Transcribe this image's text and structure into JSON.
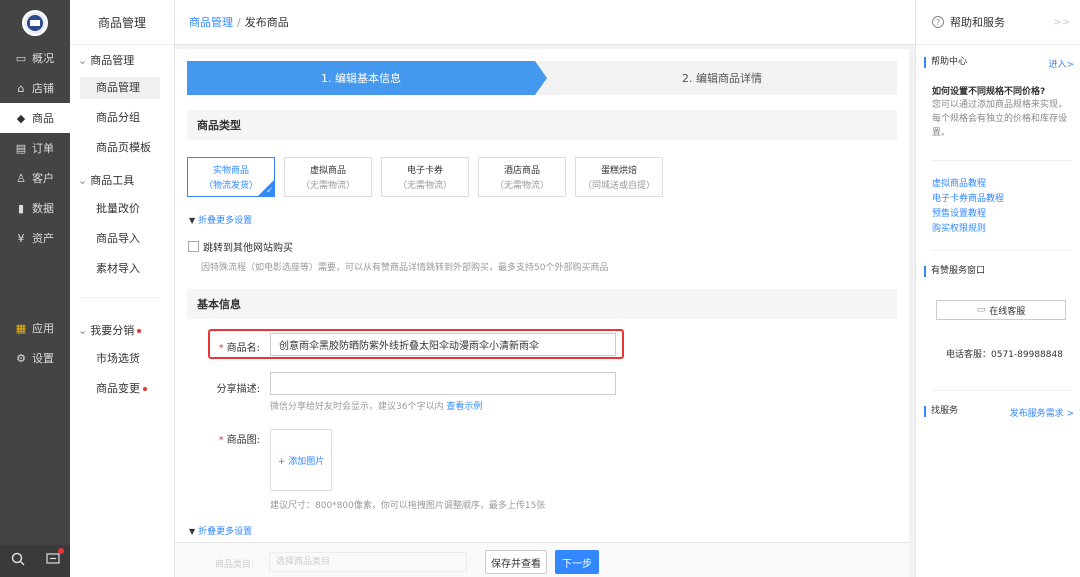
{
  "nav": {
    "items": [
      {
        "icon": "monitor-icon",
        "glyph": "▭",
        "label": "概况"
      },
      {
        "icon": "store-icon",
        "glyph": "⌂",
        "label": "店铺"
      },
      {
        "icon": "tag-icon",
        "glyph": "◆",
        "label": "商品"
      },
      {
        "icon": "order-icon",
        "glyph": "▤",
        "label": "订单"
      },
      {
        "icon": "customer-icon",
        "glyph": "♙",
        "label": "客户"
      },
      {
        "icon": "data-icon",
        "glyph": "▮",
        "label": "数据"
      },
      {
        "icon": "asset-icon",
        "glyph": "¥",
        "label": "资产"
      },
      {
        "icon": "apps-icon",
        "glyph": "▦",
        "label": "应用"
      },
      {
        "icon": "settings-icon",
        "glyph": "⚙",
        "label": "设置"
      }
    ]
  },
  "sub": {
    "title": "商品管理",
    "group1": "商品管理",
    "group1_items": [
      "商品管理",
      "商品分组",
      "商品页模板"
    ],
    "group2": "商品工具",
    "group2_items": [
      "批量改价",
      "商品导入",
      "素材导入"
    ],
    "group3": "我要分销",
    "group3_items": [
      "市场选货",
      "商品变更"
    ]
  },
  "breadcrumb": {
    "root": "商品管理",
    "sep": "/",
    "current": "发布商品"
  },
  "steps": {
    "step1": "1. 编辑基本信息",
    "step2": "2. 编辑商品详情"
  },
  "product_type": {
    "section": "商品类型",
    "cards": [
      {
        "title": "实物商品",
        "sub": "（物流发货）"
      },
      {
        "title": "虚拟商品",
        "sub": "（无需物流）"
      },
      {
        "title": "电子卡券",
        "sub": "（无需物流）"
      },
      {
        "title": "酒店商品",
        "sub": "（无需物流）"
      },
      {
        "title": "蛋糕烘焙",
        "sub": "（同城送或自提）"
      }
    ],
    "check_glyph": "✓",
    "fold_glyph": "▼",
    "fold_link": "折叠更多设置",
    "redirect_label": "跳转到其他网站购买",
    "redirect_hint": "因特殊流程（如电影选座等）需要，可以从有赞商品详情跳转到外部购买，最多支持50个外部购买商品"
  },
  "basic": {
    "section": "基本信息",
    "required_mark": "*",
    "name_label": "商品名:",
    "name_value": "创意雨伞黑胶防晒防紫外线折叠太阳伞动漫雨伞小清新雨伞",
    "share_label": "分享描述:",
    "share_value": "",
    "share_hint": "微信分享给好友时会显示，建议36个字以内",
    "share_hint_link": "查看示例",
    "image_label": "商品图:",
    "add_image": "+ 添加图片",
    "image_hint": "建议尺寸：800*800像素，你可以拖拽图片调整顺序，最多上传15张",
    "fold_link": "折叠更多设置"
  },
  "footer": {
    "ghost_label": "商品类目:",
    "ghost_select": "选择商品类目",
    "save_view": "保存并查看",
    "next": "下一步"
  },
  "help": {
    "title": "帮助和服务",
    "more_glyph": ">>",
    "center": "帮助中心",
    "enter": "进入>",
    "question": "如何设置不同规格不同价格?",
    "answer": "您可以通过添加商品规格来实现，每个规格会有独立的价格和库存设置。",
    "links": [
      "虚拟商品教程",
      "电子卡券商品教程",
      "预售设置教程",
      "购买权限规则"
    ],
    "service_window": "有赞服务窗口",
    "online_service": "在线客服",
    "phone": "电话客服：0571-89988848",
    "find_service": "找服务",
    "publish_demand": "发布服务需求 >"
  },
  "colors": {
    "accent": "#4499ee",
    "link": "#3388ff",
    "highlight": "#ee3333"
  }
}
